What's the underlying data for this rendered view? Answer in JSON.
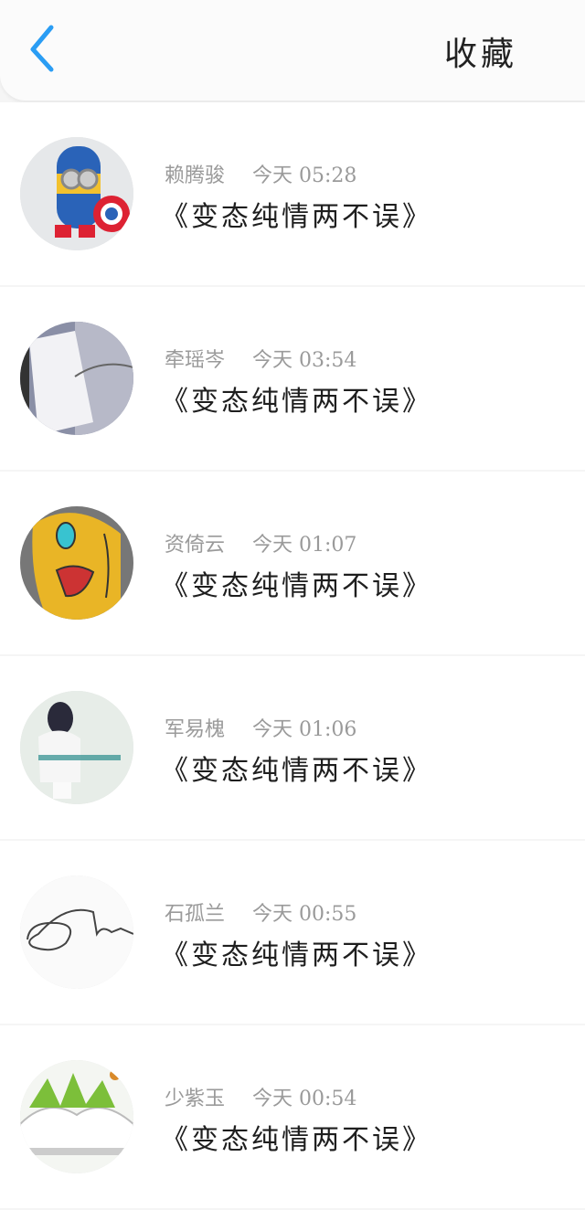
{
  "header": {
    "title": "收藏"
  },
  "items": [
    {
      "name": "赖腾骏",
      "time": "今天 05:28",
      "title": "《变态纯情两不误》"
    },
    {
      "name": "牵瑶岑",
      "time": "今天 03:54",
      "title": "《变态纯情两不误》"
    },
    {
      "name": "资倚云",
      "time": "今天 01:07",
      "title": "《变态纯情两不误》"
    },
    {
      "name": "军易槐",
      "time": "今天 01:06",
      "title": "《变态纯情两不误》"
    },
    {
      "name": "石孤兰",
      "time": "今天 00:55",
      "title": "《变态纯情两不误》"
    },
    {
      "name": "少紫玉",
      "time": "今天 00:54",
      "title": "《变态纯情两不误》"
    }
  ],
  "colors": {
    "accent": "#2a9df4"
  },
  "icons": {
    "back": "chevron-left-icon"
  }
}
